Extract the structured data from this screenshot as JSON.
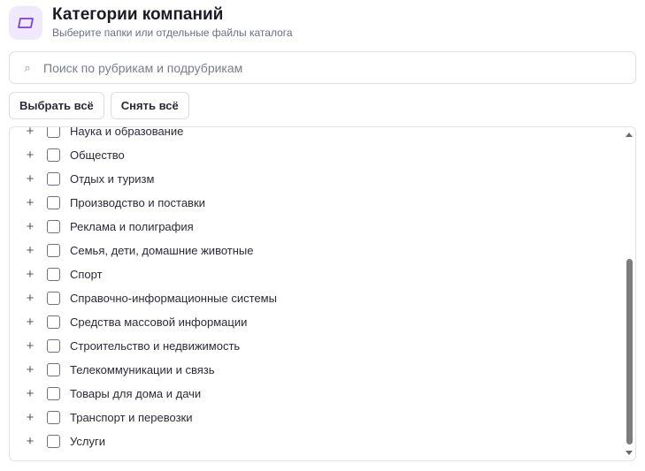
{
  "header": {
    "icon": "folder-icon",
    "title": "Категории компаний",
    "subtitle": "Выберите папки или отдельные файлы каталога"
  },
  "search": {
    "icon": "search-icon",
    "placeholder": "Поиск по рубрикам и подрубрикам",
    "value": ""
  },
  "buttons": {
    "select_all": "Выбрать всё",
    "deselect_all": "Снять всё"
  },
  "list": {
    "expand_symbol": "+",
    "items": [
      {
        "label": "Наука и образование",
        "checked": false
      },
      {
        "label": "Общество",
        "checked": false
      },
      {
        "label": "Отдых и туризм",
        "checked": false
      },
      {
        "label": "Производство и поставки",
        "checked": false
      },
      {
        "label": "Реклама и полиграфия",
        "checked": false
      },
      {
        "label": "Семья, дети, домашние животные",
        "checked": false
      },
      {
        "label": "Спорт",
        "checked": false
      },
      {
        "label": "Справочно-информационные системы",
        "checked": false
      },
      {
        "label": "Средства массовой информации",
        "checked": false
      },
      {
        "label": "Строительство и недвижимость",
        "checked": false
      },
      {
        "label": "Телекоммуникации и связь",
        "checked": false
      },
      {
        "label": "Товары для дома и дачи",
        "checked": false
      },
      {
        "label": "Транспорт и перевозки",
        "checked": false
      },
      {
        "label": "Услуги",
        "checked": false
      }
    ]
  },
  "colors": {
    "accent": "#7b3fe4",
    "accent_bg": "#efe9fb"
  }
}
